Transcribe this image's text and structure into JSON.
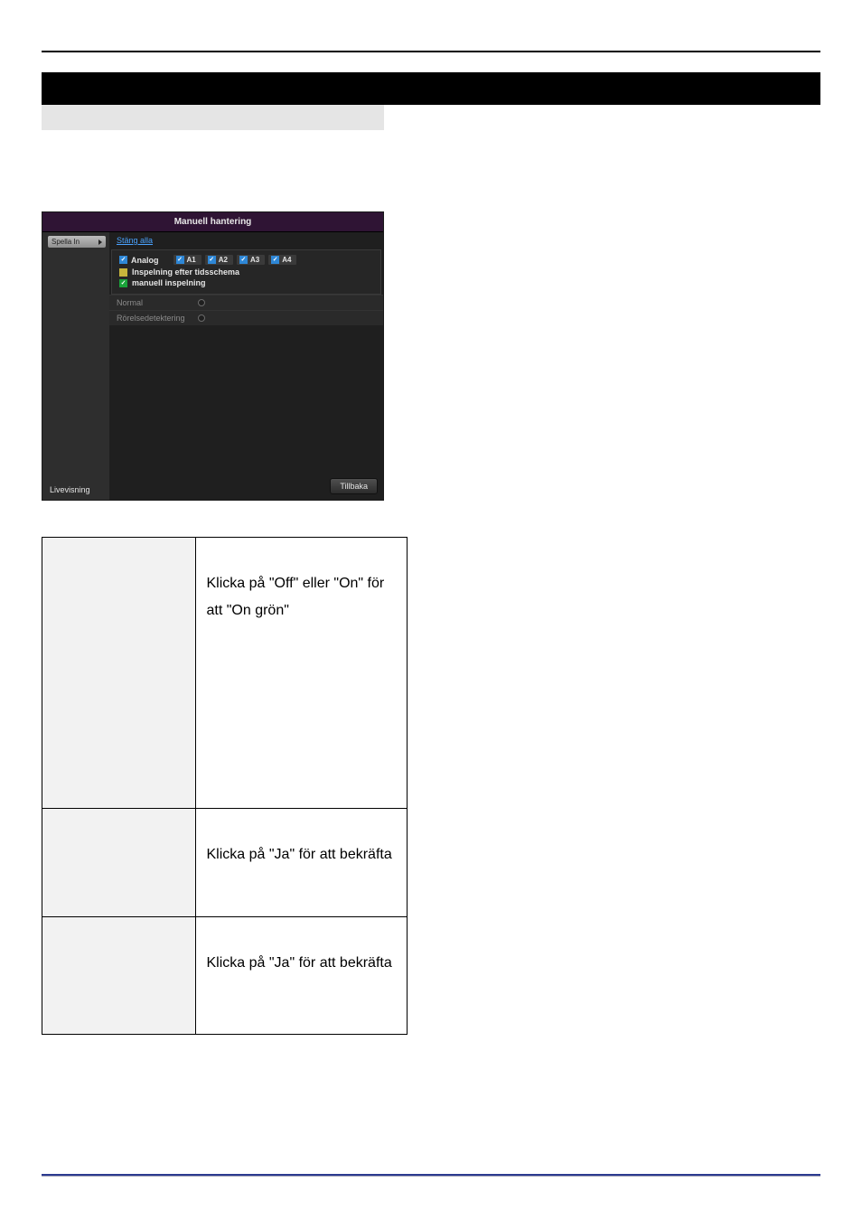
{
  "shot": {
    "header": "Manuell hantering",
    "side_top": "Spella In",
    "side_bottom": "Livevisning",
    "close_all": "Stäng alla",
    "analog_label": "Analog",
    "channels": [
      "A1",
      "A2",
      "A3",
      "A4"
    ],
    "line2": "Inspelning efter tidsschema",
    "line3": "manuell inspelning",
    "param1": "Normal",
    "param2": "Rörelsedetektering",
    "back_btn": "Tillbaka"
  },
  "table": {
    "r1": "Klicka på \"Off\" eller \"On\" för att \"On grön\"",
    "r2": "Klicka på \"Ja\" för att bekräfta",
    "r3": "Klicka på \"Ja\" för att bekräfta"
  }
}
